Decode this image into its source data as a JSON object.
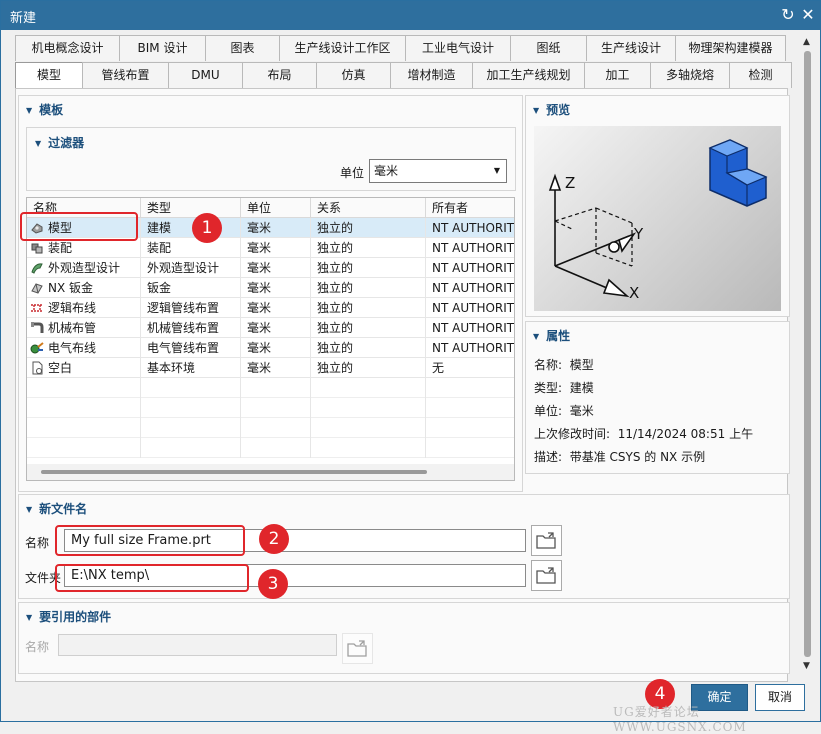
{
  "window": {
    "title": "新建",
    "refresh_glyph": "↻",
    "close_glyph": "✕"
  },
  "tabs_row1": [
    "机电概念设计",
    "BIM 设计",
    "图表",
    "生产线设计工作区",
    "工业电气设计",
    "图纸",
    "生产线设计",
    "物理架构建模器"
  ],
  "tabs_row2": [
    "模型",
    "管线布置",
    "DMU",
    "布局",
    "仿真",
    "增材制造",
    "加工生产线规划",
    "加工",
    "多轴烧熔",
    "检测"
  ],
  "active_tab": "模型",
  "template": {
    "header": "模板",
    "filter": {
      "header": "过滤器",
      "unit_label": "单位",
      "unit_value": "毫米"
    },
    "columns": [
      "名称",
      "类型",
      "单位",
      "关系",
      "所有者"
    ],
    "rows": [
      {
        "name": "模型",
        "type": "建模",
        "unit": "毫米",
        "relation": "独立的",
        "owner": "NT AUTHORITY",
        "icon": "model-icon"
      },
      {
        "name": "装配",
        "type": "装配",
        "unit": "毫米",
        "relation": "独立的",
        "owner": "NT AUTHORITY",
        "icon": "assembly-icon"
      },
      {
        "name": "外观造型设计",
        "type": "外观造型设计",
        "unit": "毫米",
        "relation": "独立的",
        "owner": "NT AUTHORITY",
        "icon": "shape-studio-icon"
      },
      {
        "name": "NX 钣金",
        "type": "钣金",
        "unit": "毫米",
        "relation": "独立的",
        "owner": "NT AUTHORITY",
        "icon": "sheet-metal-icon"
      },
      {
        "name": "逻辑布线",
        "type": "逻辑管线布置",
        "unit": "毫米",
        "relation": "独立的",
        "owner": "NT AUTHORITY",
        "icon": "logical-routing-icon"
      },
      {
        "name": "机械布管",
        "type": "机械管线布置",
        "unit": "毫米",
        "relation": "独立的",
        "owner": "NT AUTHORITY",
        "icon": "mechanical-piping-icon"
      },
      {
        "name": "电气布线",
        "type": "电气管线布置",
        "unit": "毫米",
        "relation": "独立的",
        "owner": "NT AUTHORITY",
        "icon": "electrical-routing-icon"
      },
      {
        "name": "空白",
        "type": "基本环境",
        "unit": "毫米",
        "relation": "独立的",
        "owner": "无",
        "icon": "blank-file-icon"
      }
    ]
  },
  "preview": {
    "header": "预览",
    "axis_z": "Z",
    "axis_y": "Y",
    "axis_x": "X"
  },
  "properties": {
    "header": "属性",
    "name_label": "名称:",
    "name_value": "模型",
    "type_label": "类型:",
    "type_value": "建模",
    "unit_label": "单位:",
    "unit_value": "毫米",
    "modified_label": "上次修改时间:",
    "modified_value": "11/14/2024 08:51 上午",
    "desc_label": "描述:",
    "desc_value": "带基准 CSYS 的 NX 示例"
  },
  "new_file": {
    "header": "新文件名",
    "name_label": "名称",
    "name_value": "My full size Frame.prt",
    "folder_label": "文件夹",
    "folder_value": "E:\\NX temp\\"
  },
  "referenced_part": {
    "header": "要引用的部件",
    "name_label": "名称",
    "name_value": ""
  },
  "buttons": {
    "ok": "确定",
    "cancel": "取消"
  },
  "callouts": [
    "1",
    "2",
    "3",
    "4"
  ],
  "watermark": "UG爱好者论坛 WWW.UGSNX.COM",
  "colors": {
    "title_bar": "#2e6f9e",
    "accent": "#1c4f7c",
    "callout_red": "#e0262b",
    "selected_row": "#d8ebf8"
  }
}
